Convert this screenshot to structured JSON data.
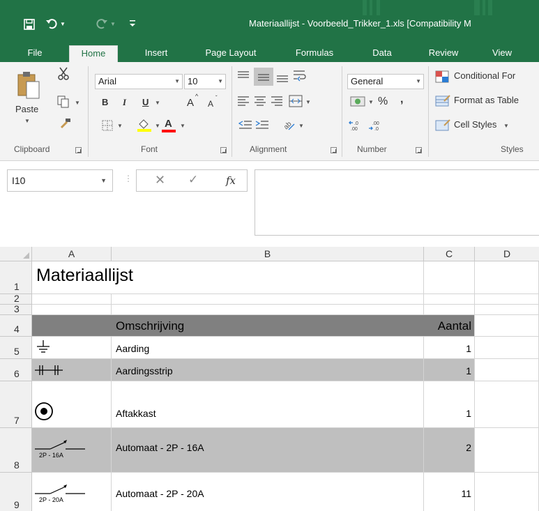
{
  "window": {
    "title": "Materiaallijst - Voorbeeld_Trikker_1.xls  [Compatibility M",
    "accent": "#217346"
  },
  "tabs": [
    "File",
    "Home",
    "Insert",
    "Page Layout",
    "Formulas",
    "Data",
    "Review",
    "View"
  ],
  "active_tab": "Home",
  "ribbon": {
    "clipboard": {
      "paste_label": "Paste",
      "group_label": "Clipboard"
    },
    "font": {
      "font_name": "Arial",
      "font_size": "10",
      "bold": "B",
      "italic": "I",
      "underline": "U",
      "grow": "A",
      "shrink": "A",
      "font_color": "A",
      "group_label": "Font"
    },
    "alignment": {
      "group_label": "Alignment"
    },
    "number": {
      "format": "General",
      "percent": "%",
      "comma": ",",
      "inc_decimal": "←.0 .00",
      "dec_decimal": ".00 →.0",
      "group_label": "Number"
    },
    "styles": {
      "conditional": "Conditional For",
      "format_table": "Format as Table",
      "cell_styles": "Cell Styles",
      "group_label": "Styles"
    }
  },
  "formula_bar": {
    "name_box": "I10",
    "fx": "fx",
    "value": ""
  },
  "sheet": {
    "columns": [
      "A",
      "B",
      "C",
      "D"
    ],
    "title": "Materiaallijst",
    "header": {
      "b": "Omschrijving",
      "c": "Aantal"
    },
    "rows": [
      {
        "row": "1"
      },
      {
        "row": "2"
      },
      {
        "row": "3"
      },
      {
        "row": "4"
      },
      {
        "row": "5",
        "symbol": "earth-symbol",
        "description": "Aarding",
        "count": "1"
      },
      {
        "row": "6",
        "symbol": "earth-strip-symbol",
        "description": "Aardingsstrip",
        "count": "1"
      },
      {
        "row": "7",
        "symbol": "junction-box-symbol",
        "description": "Aftakkast",
        "count": "1"
      },
      {
        "row": "8",
        "symbol": "breaker-symbol",
        "symbol_label": "2P - 16A",
        "description": "Automaat - 2P - 16A",
        "count": "2"
      },
      {
        "row": "9",
        "symbol": "breaker-symbol",
        "symbol_label": "2P - 20A",
        "description": "Automaat - 2P - 20A",
        "count": "11"
      }
    ],
    "colors": {
      "header_fill": "#808080",
      "band_fill": "#bfbfbf"
    }
  }
}
